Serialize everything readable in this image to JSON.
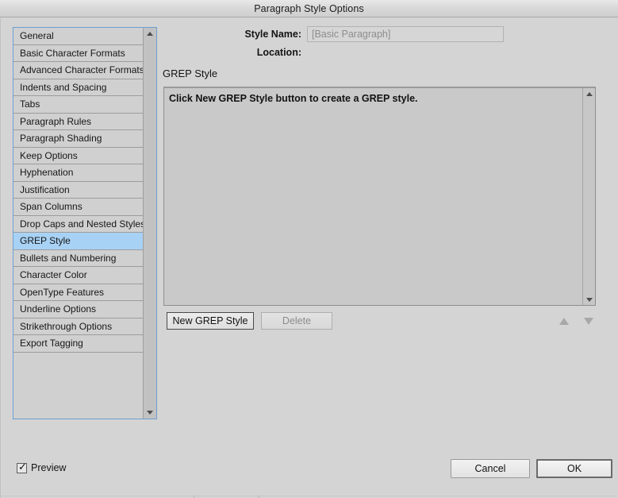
{
  "window": {
    "title": "Paragraph Style Options"
  },
  "sidebar": {
    "items": [
      {
        "label": "General",
        "selected": false
      },
      {
        "label": "Basic Character Formats",
        "selected": false
      },
      {
        "label": "Advanced Character Formats",
        "selected": false
      },
      {
        "label": "Indents and Spacing",
        "selected": false
      },
      {
        "label": "Tabs",
        "selected": false
      },
      {
        "label": "Paragraph Rules",
        "selected": false
      },
      {
        "label": "Paragraph Shading",
        "selected": false
      },
      {
        "label": "Keep Options",
        "selected": false
      },
      {
        "label": "Hyphenation",
        "selected": false
      },
      {
        "label": "Justification",
        "selected": false
      },
      {
        "label": "Span Columns",
        "selected": false
      },
      {
        "label": "Drop Caps and Nested Styles",
        "selected": false
      },
      {
        "label": "GREP Style",
        "selected": true
      },
      {
        "label": "Bullets and Numbering",
        "selected": false
      },
      {
        "label": "Character Color",
        "selected": false
      },
      {
        "label": "OpenType Features",
        "selected": false
      },
      {
        "label": "Underline Options",
        "selected": false
      },
      {
        "label": "Strikethrough Options",
        "selected": false
      },
      {
        "label": "Export Tagging",
        "selected": false
      }
    ],
    "scroll_up_icon": "triangle-up-icon",
    "scroll_down_icon": "triangle-down-icon"
  },
  "form": {
    "style_name_label": "Style Name:",
    "style_name_value": "[Basic Paragraph]",
    "style_name_placeholder": "[Basic Paragraph]",
    "location_label": "Location:",
    "location_value": ""
  },
  "panel": {
    "heading": "GREP Style",
    "empty_message": "Click New GREP Style button to create a GREP style.",
    "scroll_up_icon": "triangle-up-icon",
    "scroll_down_icon": "triangle-down-icon",
    "new_grep_style_label": "New GREP Style",
    "delete_label": "Delete",
    "move_up_icon": "triangle-up-icon",
    "move_down_icon": "triangle-down-icon"
  },
  "footer": {
    "preview_label": "Preview",
    "preview_checked": true,
    "preview_check_glyph": "✓",
    "cancel_label": "Cancel",
    "ok_label": "OK"
  },
  "colors": {
    "dialog_background": "#d4d4d4",
    "titlebar_background": "#d8d8d8",
    "selection_blue": "#a8d2f5",
    "list_border_blue": "#6b9fd1",
    "listbox_background": "#c9c9c9",
    "disabled_text": "#8c8c8c"
  }
}
